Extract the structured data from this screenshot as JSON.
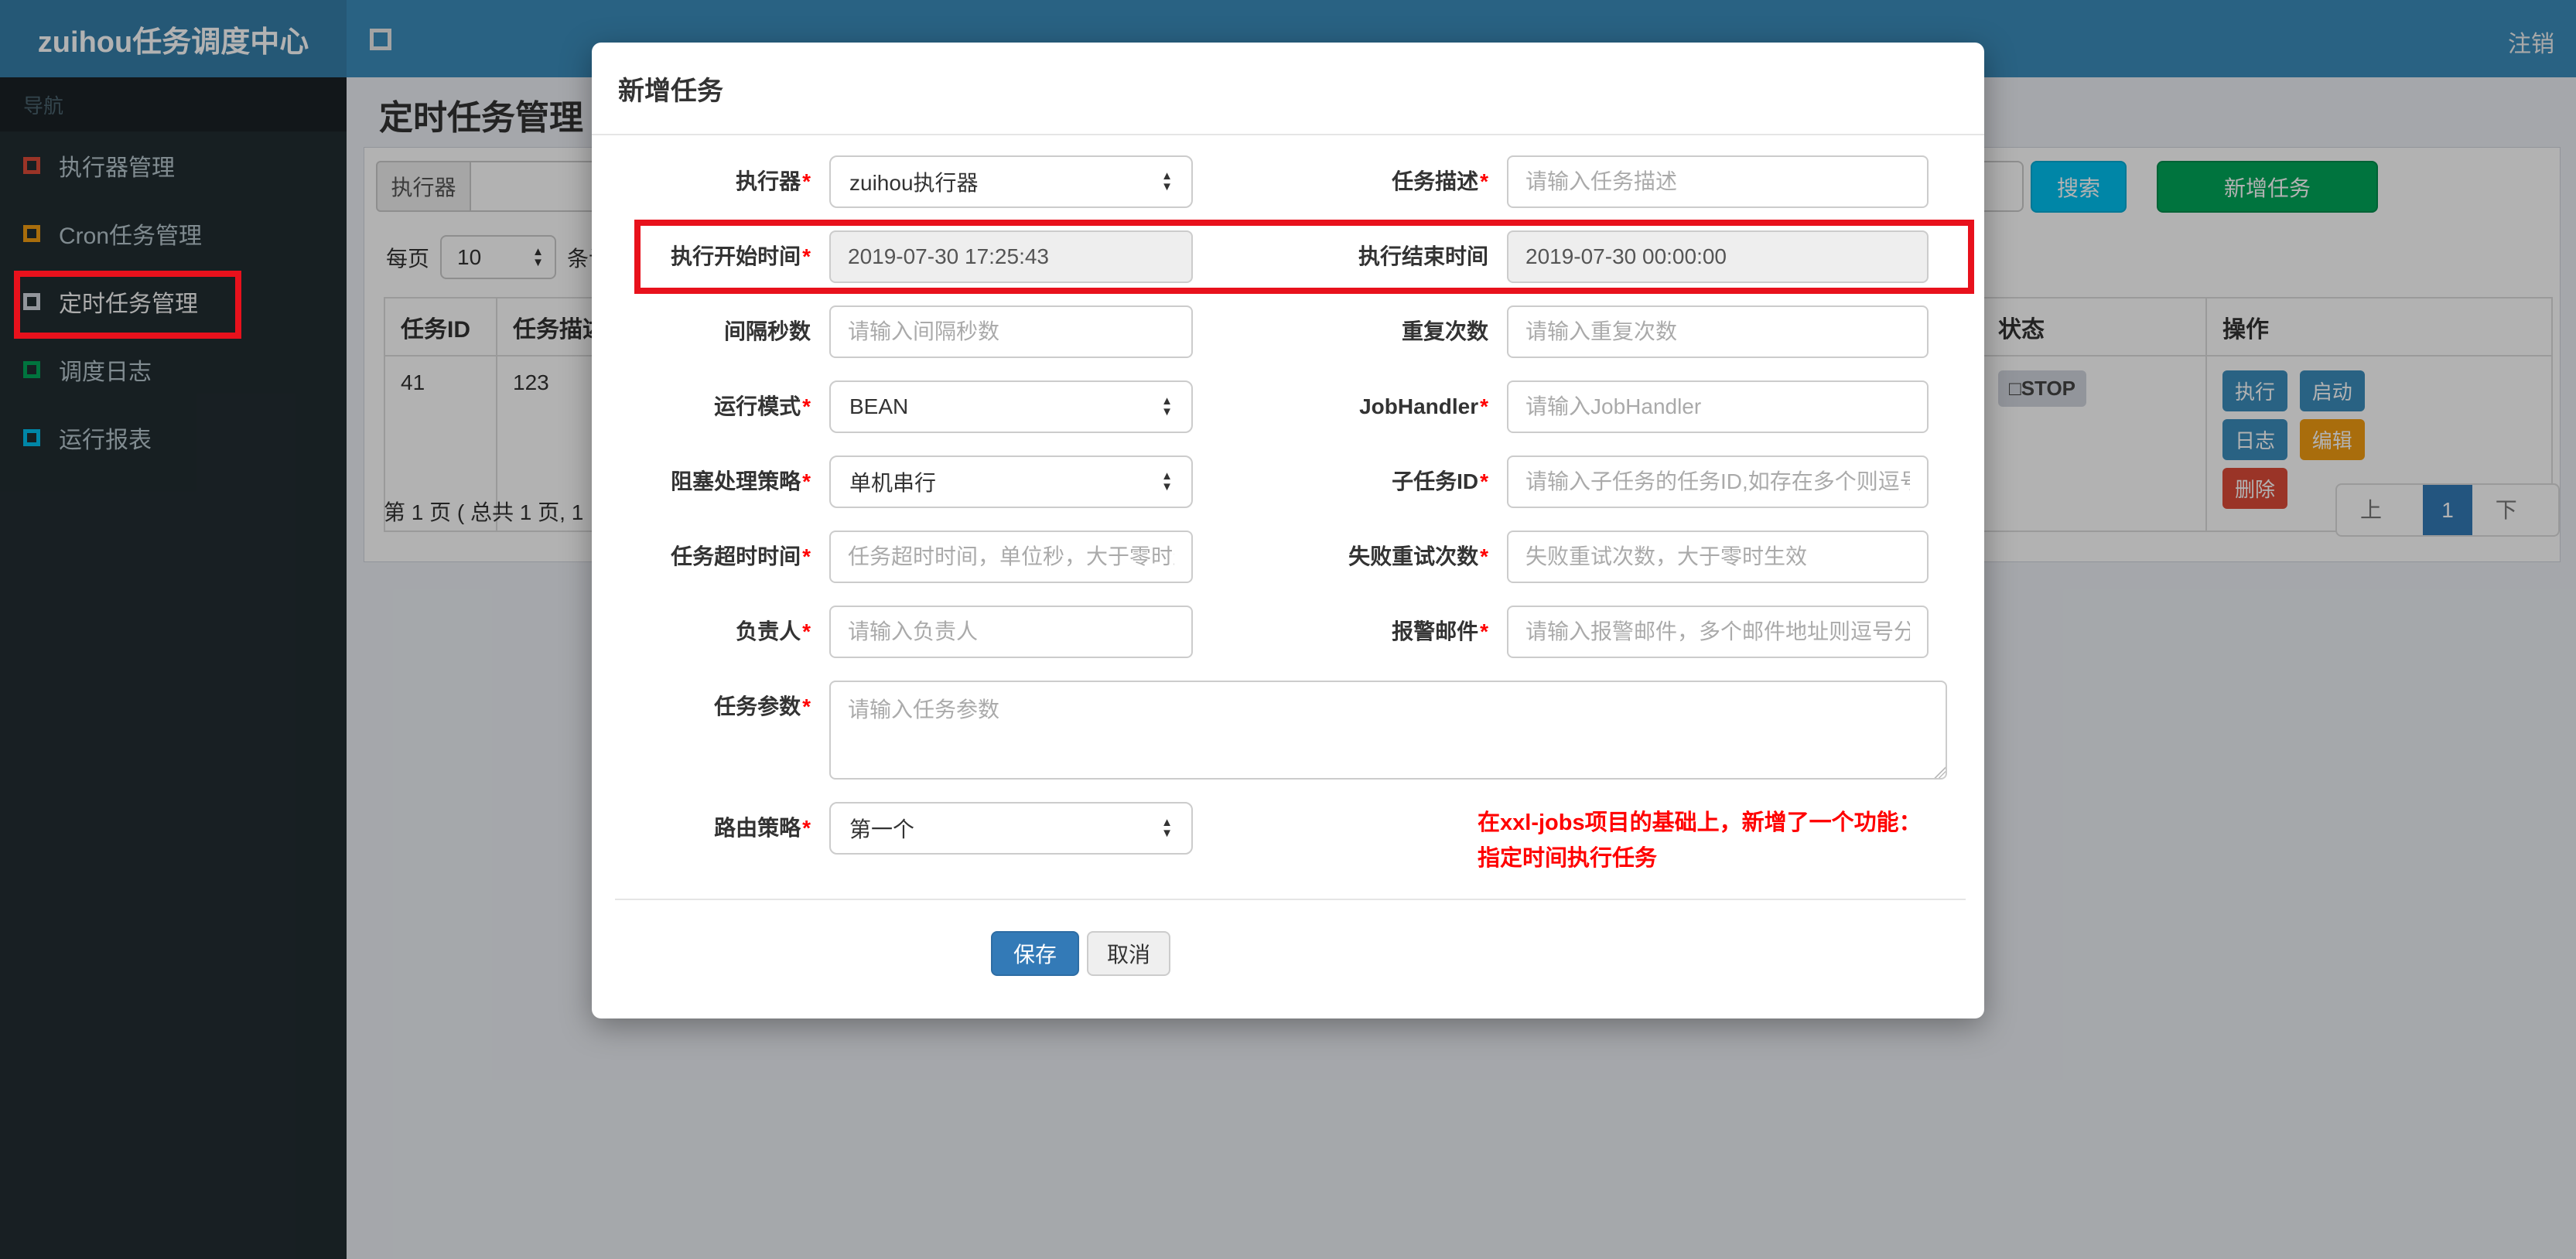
{
  "ui": {
    "required_marker": "*",
    "arrow_up": "▲",
    "arrow_down": "▼"
  },
  "colors": {
    "navbar": "#3c8dbc",
    "logo_bg": "#367fa9",
    "sidebar_bg": "#222d32",
    "search_btn": "#00c0ef",
    "add_btn": "#00a65a",
    "primary_btn": "#337ab7",
    "warning_btn": "#f39c12",
    "danger_btn": "#dd4b39",
    "annotation_red": "#e8111c",
    "note_red": "#ff0000"
  },
  "chrome": {
    "logo": "zuihou任务调度中心",
    "logout": "注销",
    "nav_header": "导航"
  },
  "sidebar": {
    "items": [
      {
        "label": "执行器管理",
        "icon_color": "#dd4b39"
      },
      {
        "label": "Cron任务管理",
        "icon_color": "#f39c12"
      },
      {
        "label": "定时任务管理",
        "icon_color": "#d2d6de"
      },
      {
        "label": "调度日志",
        "icon_color": "#00a65a"
      },
      {
        "label": "运行报表",
        "icon_color": "#00c0ef"
      }
    ]
  },
  "page": {
    "title": "定时任务管理"
  },
  "filter": {
    "executor_label": "执行器",
    "executor_value": "",
    "desc_value": "",
    "search_button": "搜索",
    "add_button": "新增任务"
  },
  "perpage": {
    "prefix": "每页",
    "value": "10",
    "suffix": "条记录"
  },
  "table": {
    "headers": {
      "job_id": "任务ID",
      "job_desc": "任务描述",
      "status": "状态",
      "actions": "操作"
    },
    "row": {
      "job_id": "41",
      "job_desc": "123",
      "status": "□STOP",
      "actions": [
        "执行",
        "启动",
        "日志",
        "编辑",
        "删除"
      ]
    }
  },
  "pagination": {
    "info": "第 1 页 ( 总共 1 页, 1",
    "prev": "上页",
    "current": "1",
    "next": "下页"
  },
  "modal": {
    "title": "新增任务",
    "fields": {
      "executor": {
        "label": "执行器",
        "value": "zuihou执行器"
      },
      "job_desc": {
        "label": "任务描述",
        "placeholder": "请输入任务描述"
      },
      "start_time": {
        "label": "执行开始时间",
        "value": "2019-07-30 17:25:43"
      },
      "end_time": {
        "label": "执行结束时间",
        "value": "2019-07-30 00:00:00"
      },
      "interval": {
        "label": "间隔秒数",
        "placeholder": "请输入间隔秒数"
      },
      "repeat_count": {
        "label": "重复次数",
        "placeholder": "请输入重复次数"
      },
      "glue_type": {
        "label": "运行模式",
        "value": "BEAN"
      },
      "job_handler": {
        "label": "JobHandler",
        "placeholder": "请输入JobHandler"
      },
      "block_strategy": {
        "label": "阻塞处理策略",
        "value": "单机串行"
      },
      "child_job": {
        "label": "子任务ID",
        "placeholder": "请输入子任务的任务ID,如存在多个则逗号分隔"
      },
      "timeout": {
        "label": "任务超时时间",
        "placeholder": "任务超时时间，单位秒，大于零时生效"
      },
      "retry": {
        "label": "失败重试次数",
        "placeholder": "失败重试次数，大于零时生效"
      },
      "author": {
        "label": "负责人",
        "placeholder": "请输入负责人"
      },
      "alarm_email": {
        "label": "报警邮件",
        "placeholder": "请输入报警邮件，多个邮件地址则逗号分隔"
      },
      "job_param": {
        "label": "任务参数",
        "placeholder": "请输入任务参数"
      },
      "route_strategy": {
        "label": "路由策略",
        "value": "第一个"
      }
    },
    "note_line1": "在xxl-jobs项目的基础上，新增了一个功能：",
    "note_line2": "指定时间执行任务",
    "save_button": "保存",
    "cancel_button": "取消"
  }
}
